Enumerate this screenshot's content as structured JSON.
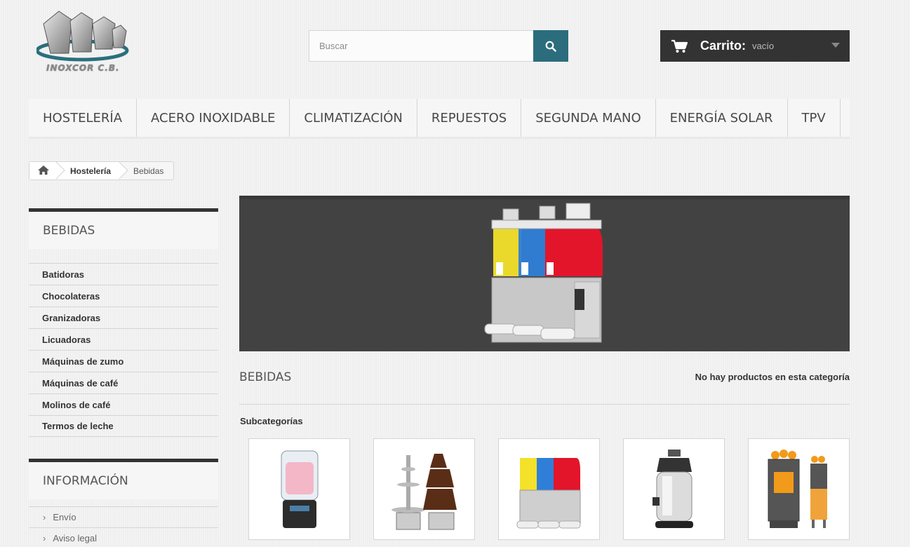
{
  "logo": {
    "text": "INOXCOR C.B."
  },
  "search": {
    "placeholder": "Buscar"
  },
  "cart": {
    "label": "Carrito:",
    "status": "vacío"
  },
  "top_menu": [
    "HOSTELERÍA",
    "ACERO INOXIDABLE",
    "CLIMATIZACIÓN",
    "REPUESTOS",
    "SEGUNDA MANO",
    "ENERGÍA SOLAR",
    "TPV"
  ],
  "breadcrumb": {
    "parent": "Hostelería",
    "current": "Bebidas"
  },
  "categories_block": {
    "title": "BEBIDAS",
    "items": [
      "Batidoras",
      "Chocolateras",
      "Granizadoras",
      "Licuadoras",
      "Máquinas de zumo",
      "Máquinas de café",
      "Molinos de café",
      "Termos de leche"
    ]
  },
  "info_block": {
    "title": "INFORMACIÓN",
    "items": [
      "Envío",
      "Aviso legal"
    ]
  },
  "category": {
    "heading": "BEBIDAS",
    "no_products": "No hay productos en esta categoría",
    "subcategories_title": "Subcategorías"
  },
  "colors": {
    "search_button": "#2b6d7d",
    "cart_bg": "#333333",
    "banner_bg": "#424242"
  }
}
